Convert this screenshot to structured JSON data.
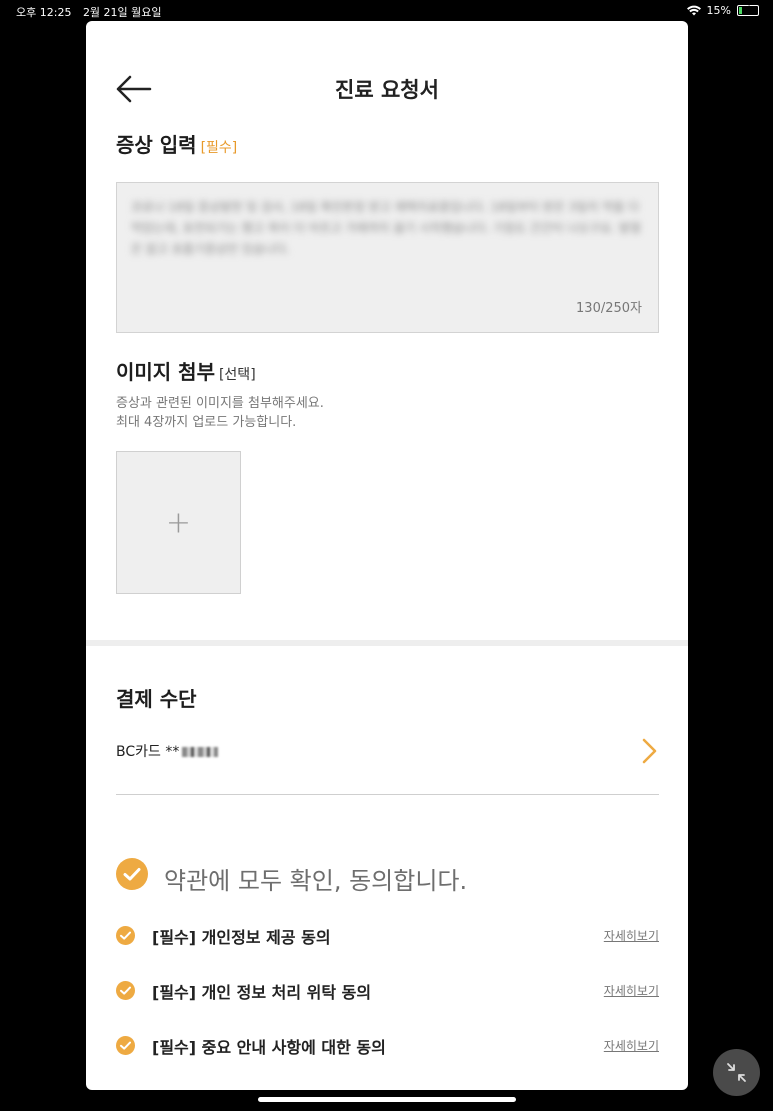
{
  "status_bar": {
    "time": "오후 12:25",
    "date": "2월 21일 월요일",
    "battery": "15%",
    "battery_level": 0.15
  },
  "header": {
    "title": "진료 요청서"
  },
  "symptom": {
    "title": "증상 입력",
    "tag": "[필수]",
    "text": "코로나 18일 증상발현 및 검사, 18일 확진판정 받고 재택치료중입니다. 18일부터 받은 3일치 약을 다먹었는데, 호전되기는 했고 목이 더 아프고 가래까지 끓기 시작했습니다. 기침도 간간이 나오구요. 발열은 없고 호흡기증상만 있습니다.",
    "char_count": "130/250자"
  },
  "image_attach": {
    "title": "이미지 첨부",
    "tag": "[선택]",
    "helper_line1": "증상과 관련된 이미지를 첨부해주세요.",
    "helper_line2": "최대 4장까지 업로드 가능합니다.",
    "add_symbol": "+"
  },
  "payment": {
    "title": "결제 수단",
    "card_label": "BC카드 **"
  },
  "agreements": {
    "all_label": "약관에 모두 확인, 동의합니다.",
    "items": [
      {
        "label": "[필수] 개인정보 제공 동의",
        "link": "자세히보기"
      },
      {
        "label": "[필수] 개인 정보 처리 위탁 동의",
        "link": "자세히보기"
      },
      {
        "label": "[필수] 중요 안내 사항에 대한 동의",
        "link": "자세히보기"
      }
    ]
  },
  "colors": {
    "accent": "#eeaa42",
    "box_bg": "#efefef"
  }
}
